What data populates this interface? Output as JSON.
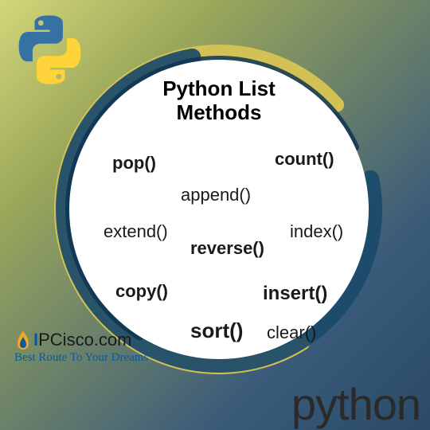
{
  "title_line1": "Python List",
  "title_line2": "Methods",
  "methods": {
    "pop": "pop()",
    "count": "count()",
    "append": "append()",
    "extend": "extend()",
    "reverse": "reverse()",
    "index": "index()",
    "copy": "copy()",
    "insert": "insert()",
    "sort": "sort()",
    "clear": "clear()"
  },
  "branding": {
    "site_letter": "I",
    "site_rest": "PCisco.com",
    "tagline": "Best Route To Your Dreams"
  },
  "footer_word": "python",
  "icons": {
    "python_logo": "python-logo-icon",
    "flame": "flame-icon"
  }
}
